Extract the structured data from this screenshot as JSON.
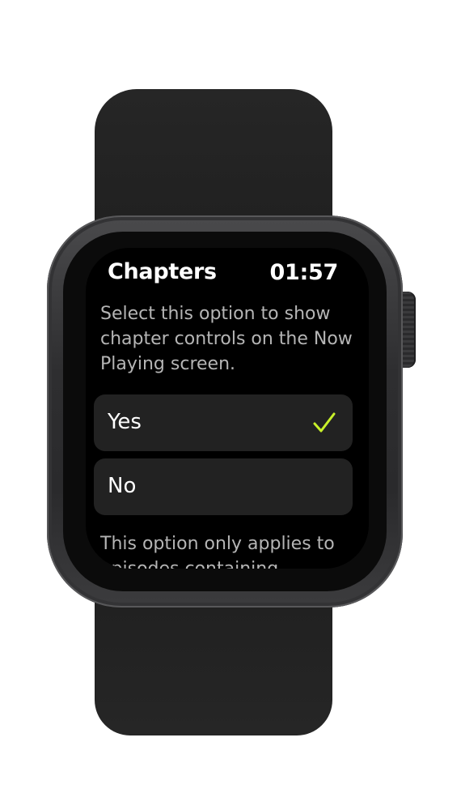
{
  "screen": {
    "title": "Chapters",
    "time": "01:57",
    "description": "Select this option to show chapter controls on the Now Playing screen.",
    "options": [
      {
        "label": "Yes",
        "selected": true
      },
      {
        "label": "No",
        "selected": false
      }
    ],
    "footer_note": "This option only applies to episodes containing"
  },
  "icons": {
    "selected_indicator": "checkmark-icon"
  },
  "colors": {
    "accent": "#c8f02a",
    "background": "#000000",
    "option_background": "#222222",
    "text_primary": "#ffffff",
    "text_secondary": "#b5b5b5"
  }
}
